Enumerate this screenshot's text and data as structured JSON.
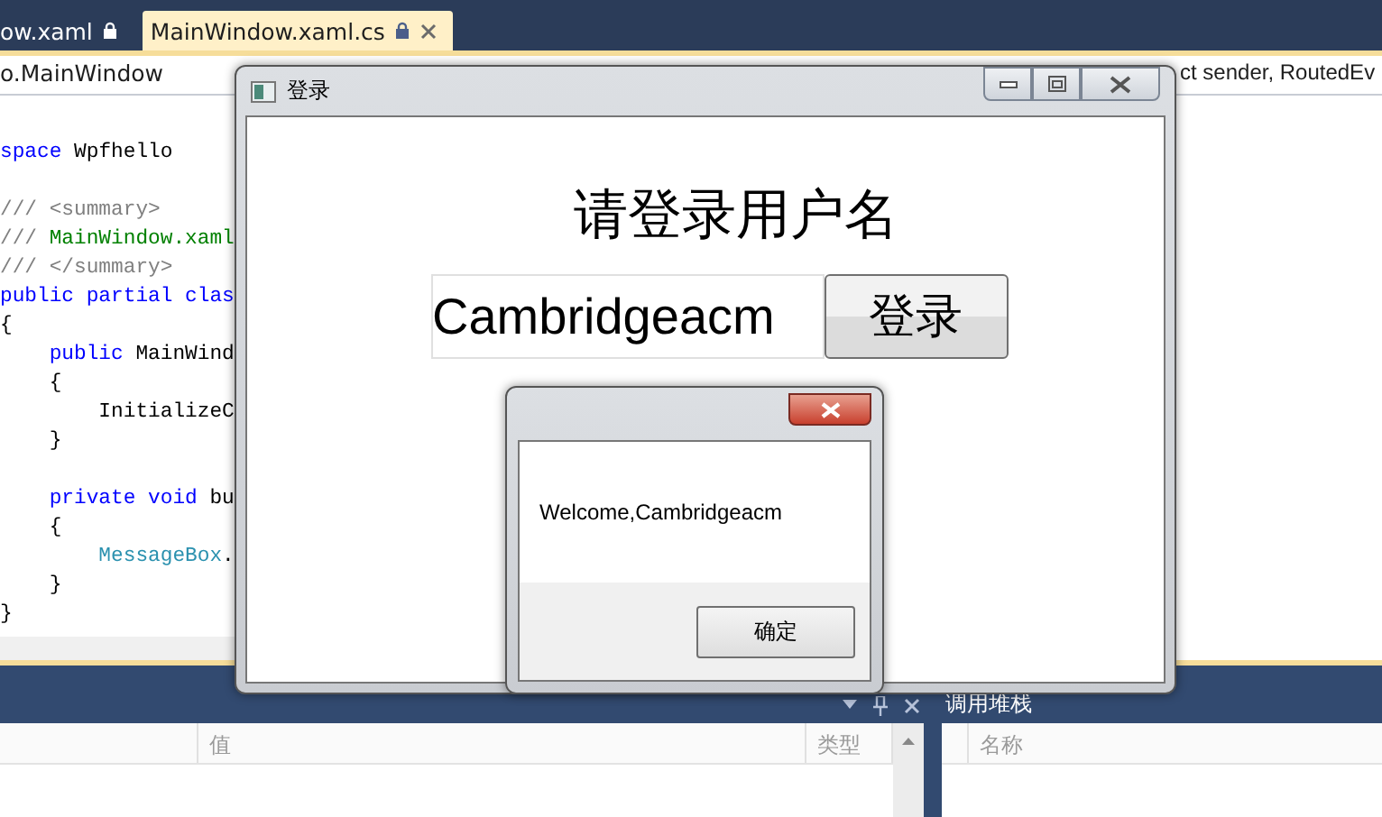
{
  "editor_tabs": [
    {
      "label": "ow.xaml",
      "selected": false,
      "locked": true
    },
    {
      "label": "MainWindow.xaml.cs",
      "selected": true,
      "locked": true
    }
  ],
  "nav_bar": {
    "type_dropdown": "o.MainWindow",
    "member_dropdown": "ct sender, RoutedEv"
  },
  "code_lines": [
    {
      "kind": "code",
      "tokens": [
        {
          "kind": "keyword",
          "text": "space"
        },
        {
          "kind": "plain",
          "text": " Wpfhello"
        }
      ]
    },
    {
      "kind": "blank"
    },
    {
      "kind": "code",
      "tokens": [
        {
          "kind": "comment",
          "text": "/// <summary>"
        }
      ]
    },
    {
      "kind": "code",
      "tokens": [
        {
          "kind": "comment",
          "text": "/// "
        },
        {
          "kind": "doc",
          "text": "MainWindow.xaml"
        }
      ]
    },
    {
      "kind": "code",
      "tokens": [
        {
          "kind": "comment",
          "text": "/// </summary>"
        }
      ]
    },
    {
      "kind": "code",
      "tokens": [
        {
          "kind": "keyword",
          "text": "public partial clas"
        }
      ]
    },
    {
      "kind": "code",
      "tokens": [
        {
          "kind": "plain",
          "text": "{"
        }
      ]
    },
    {
      "kind": "code",
      "tokens": [
        {
          "kind": "keyword",
          "text": "    public"
        },
        {
          "kind": "plain",
          "text": " MainWind"
        }
      ]
    },
    {
      "kind": "code",
      "tokens": [
        {
          "kind": "plain",
          "text": "    {"
        }
      ]
    },
    {
      "kind": "code",
      "tokens": [
        {
          "kind": "plain",
          "text": "        InitializeC"
        }
      ]
    },
    {
      "kind": "code",
      "tokens": [
        {
          "kind": "plain",
          "text": "    }"
        }
      ]
    },
    {
      "kind": "blank"
    },
    {
      "kind": "code",
      "tokens": [
        {
          "kind": "keyword",
          "text": "    private void"
        },
        {
          "kind": "plain",
          "text": " bu"
        }
      ]
    },
    {
      "kind": "code",
      "tokens": [
        {
          "kind": "plain",
          "text": "    {"
        }
      ]
    },
    {
      "kind": "code",
      "tokens": [
        {
          "kind": "type",
          "text": "        MessageBox"
        },
        {
          "kind": "plain",
          "text": "."
        }
      ]
    },
    {
      "kind": "code",
      "tokens": [
        {
          "kind": "plain",
          "text": "    }"
        }
      ]
    },
    {
      "kind": "code",
      "tokens": [
        {
          "kind": "plain",
          "text": "}"
        }
      ]
    }
  ],
  "locals_panel": {
    "columns": [
      {
        "label": "值"
      },
      {
        "label": "类型"
      }
    ]
  },
  "call_stack_panel": {
    "title": "调用堆栈",
    "columns": [
      {
        "label": "名称"
      }
    ]
  },
  "login_window": {
    "title": "登录",
    "prompt": "请登录用户名",
    "username_value": "Cambridgeacm",
    "login_button": "登录"
  },
  "message_box": {
    "message": "Welcome,Cambridgeacm",
    "ok_button": "确定"
  }
}
